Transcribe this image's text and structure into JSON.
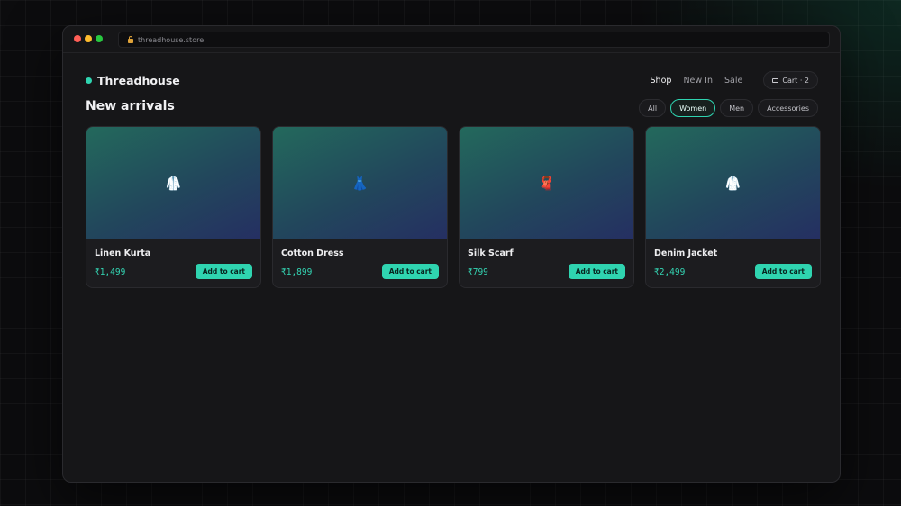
{
  "browser": {
    "url": "threadhouse.store"
  },
  "brand": {
    "name": "Threadhouse",
    "accent": "#2fd4b0"
  },
  "nav": {
    "links": [
      {
        "label": "Shop",
        "active": true
      },
      {
        "label": "New In",
        "active": false
      },
      {
        "label": "Sale",
        "active": false
      }
    ],
    "cart_label": "Cart · 2"
  },
  "page": {
    "title": "New arrivals"
  },
  "filters": [
    {
      "label": "All",
      "active": false
    },
    {
      "label": "Women",
      "active": true
    },
    {
      "label": "Men",
      "active": false
    },
    {
      "label": "Accessories",
      "active": false
    }
  ],
  "products": [
    {
      "name": "Linen Kurta",
      "price": "₹1,499",
      "emoji": "🥼",
      "icon": "kurta-icon",
      "button": "Add to cart"
    },
    {
      "name": "Cotton Dress",
      "price": "₹1,899",
      "emoji": "👗",
      "icon": "dress-icon",
      "button": "Add to cart"
    },
    {
      "name": "Silk Scarf",
      "price": "₹799",
      "emoji": "🧣",
      "icon": "scarf-icon",
      "button": "Add to cart"
    },
    {
      "name": "Denim Jacket",
      "price": "₹2,499",
      "emoji": "🥼",
      "icon": "jacket-icon",
      "button": "Add to cart"
    }
  ]
}
